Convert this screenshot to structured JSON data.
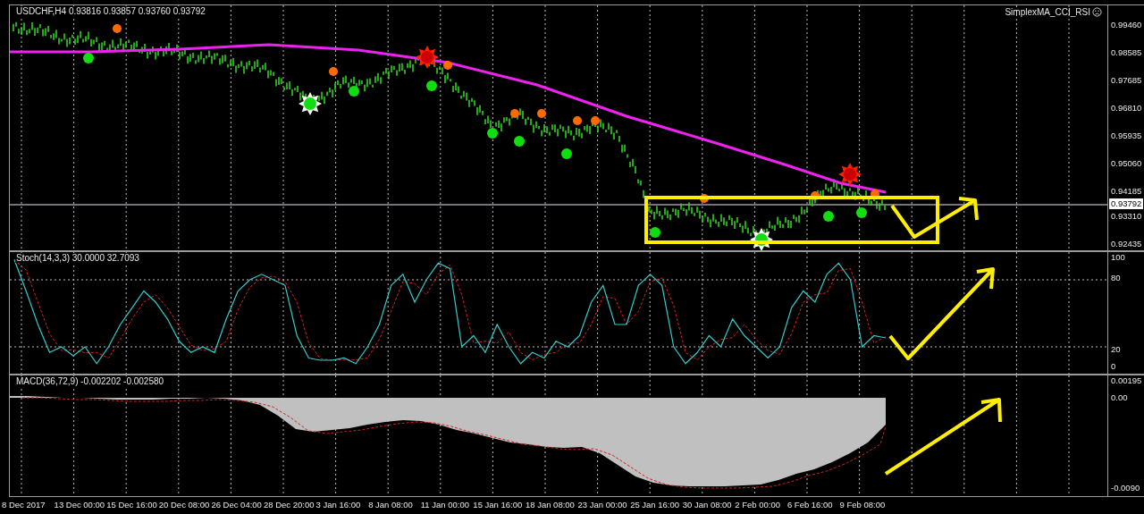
{
  "main_chart": {
    "header": "USDCHF,H4  0.93816 0.93857 0.93760 0.93792",
    "indicator": "SimplexMA_CCI_RSI",
    "price_axis": [
      "0.99460",
      "0.98585",
      "0.97685",
      "0.96810",
      "0.95935",
      "0.95060",
      "0.94185",
      "0.93310",
      "0.92435"
    ],
    "current_price": "0.93792"
  },
  "stochastic": {
    "label": "Stoch(14,3,3) 30.0000 32.7093",
    "axis_labels": [
      "100",
      "80",
      "20",
      "0"
    ]
  },
  "macd": {
    "label": "MACD(36,72,9) -0.002202 -0.002580",
    "axis_labels": [
      "0.00195",
      "0.00",
      "-0.0090"
    ]
  },
  "time_axis": [
    "8 Dec 2017",
    "13 Dec 00:00",
    "15 Dec 16:00",
    "20 Dec 08:00",
    "26 Dec 04:00",
    "28 Dec 20:00",
    "3 Jan 16:00",
    "8 Jan 08:00",
    "11 Jan 00:00",
    "15 Jan 16:00",
    "18 Jan 08:00",
    "23 Jan 00:00",
    "25 Jan 16:00",
    "30 Jan 08:00",
    "2 Feb 00:00",
    "6 Feb 16:00",
    "9 Feb 08:00"
  ]
}
